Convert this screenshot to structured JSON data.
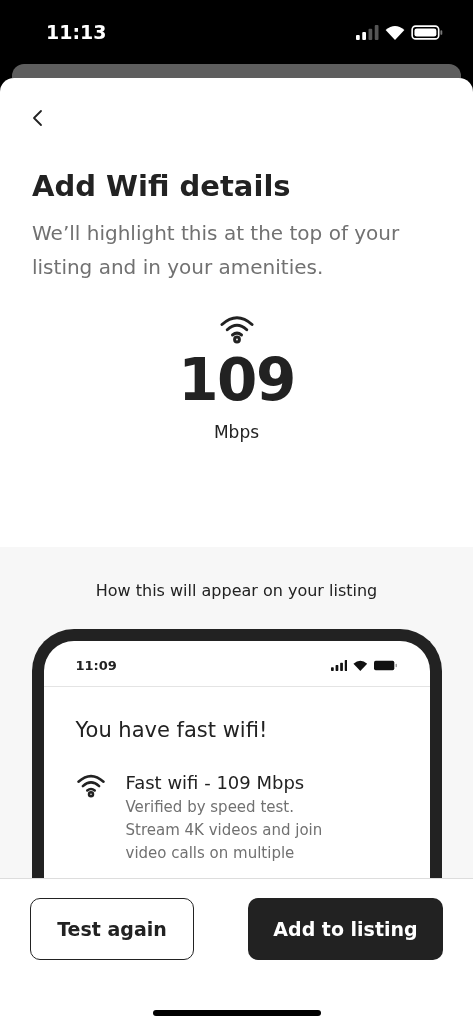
{
  "status_bar": {
    "time": "11:13"
  },
  "title": "Add Wifi details",
  "subtitle": "We’ll highlight this at the top of your listing and in your amenities.",
  "speed": {
    "value": "109",
    "unit": "Mbps"
  },
  "preview": {
    "caption": "How this will appear on your listing",
    "phone": {
      "time": "11:09",
      "heading": "You have fast wifi!",
      "feature_title": "Fast wifi - 109 Mbps",
      "feature_description": "Verified by speed test. Stream 4K videos and join video calls on multiple"
    }
  },
  "buttons": [
    {
      "label": "Test again",
      "kind": "secondary"
    },
    {
      "label": "Add to listing",
      "kind": "primary"
    }
  ]
}
